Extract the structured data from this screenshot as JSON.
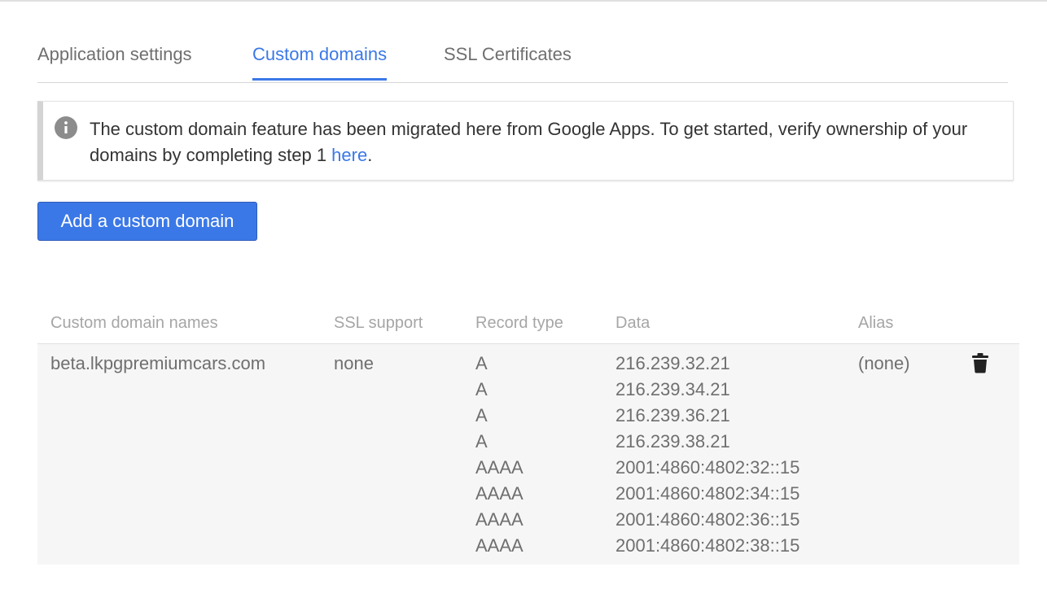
{
  "tabs": {
    "app_settings": "Application settings",
    "custom_domains": "Custom domains",
    "ssl_certificates": "SSL Certificates"
  },
  "banner": {
    "text": "The custom domain feature has been migrated here from Google Apps. To get started, verify ownership of your domains by completing step 1 ",
    "link": "here",
    "period": "."
  },
  "actions": {
    "add_label": "Add a custom domain"
  },
  "table": {
    "headers": {
      "name": "Custom domain names",
      "ssl": "SSL support",
      "record_type": "Record type",
      "data": "Data",
      "alias": "Alias"
    },
    "row": {
      "name": "beta.lkpgpremiumcars.com",
      "ssl": "none",
      "alias": "(none)",
      "records": [
        {
          "type": "A",
          "data": "216.239.32.21"
        },
        {
          "type": "A",
          "data": "216.239.34.21"
        },
        {
          "type": "A",
          "data": "216.239.36.21"
        },
        {
          "type": "A",
          "data": "216.239.38.21"
        },
        {
          "type": "AAAA",
          "data": "2001:4860:4802:32::15"
        },
        {
          "type": "AAAA",
          "data": "2001:4860:4802:34::15"
        },
        {
          "type": "AAAA",
          "data": "2001:4860:4802:36::15"
        },
        {
          "type": "AAAA",
          "data": "2001:4860:4802:38::15"
        }
      ]
    }
  },
  "colors": {
    "accent": "#3b78e7",
    "text": "#6f6f6f",
    "header_text": "#a6a6a6",
    "row_bg": "#f6f6f6"
  },
  "icons": {
    "info": "info-icon",
    "delete": "trash-icon"
  }
}
